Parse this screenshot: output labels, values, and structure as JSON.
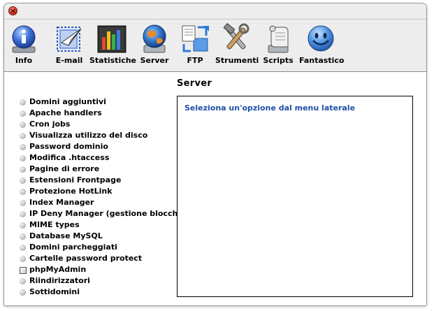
{
  "toolbar": {
    "items": [
      {
        "label": "Info",
        "icon": "info-icon"
      },
      {
        "label": "E-mail",
        "icon": "email-stamp-icon"
      },
      {
        "label": "Statistiche",
        "icon": "bar-chart-icon"
      },
      {
        "label": "Server",
        "icon": "globe-icon"
      },
      {
        "label": "FTP",
        "icon": "ftp-transfer-icon"
      },
      {
        "label": "Strumenti",
        "icon": "tools-icon"
      },
      {
        "label": "Scripts",
        "icon": "scroll-icon"
      },
      {
        "label": "Fantastico",
        "icon": "smiley-icon"
      }
    ]
  },
  "content": {
    "title": "Server",
    "menu": [
      "Domini aggiuntivi",
      "Apache handlers",
      "Cron jobs",
      "Visualizza utilizzo del disco",
      "Password dominio",
      "Modifica .htaccess",
      "Pagine di errore",
      "Estensioni Frontpage",
      "Protezione HotLink",
      "Index Manager",
      "IP Deny Manager (gestione blocchi IP)",
      "MIME types",
      "Database MySQL",
      "Domini parcheggiati",
      "Cartelle password protect",
      "phpMyAdmin",
      "Riindirizzatori",
      "Sottidomini"
    ],
    "panel_message": "Seleziona un'opzione dal menu laterale"
  },
  "colors": {
    "panel_message": "#1e4fa6",
    "close_button": "#e0412c"
  }
}
